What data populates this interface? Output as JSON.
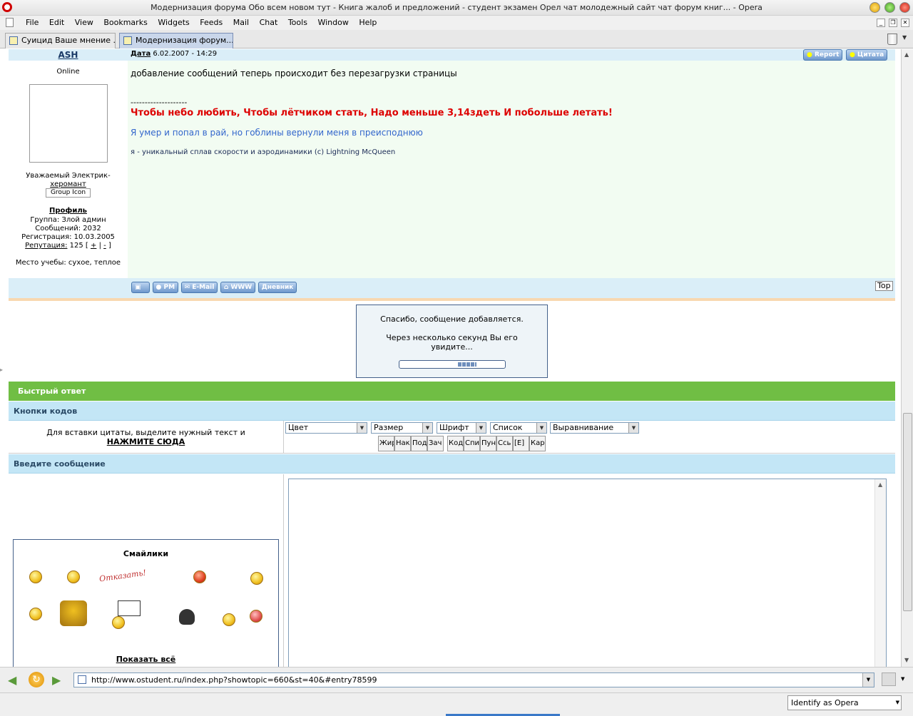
{
  "window": {
    "title": "Модернизация форума Обо всем новом тут - Книга жалоб и предложений - студент экзамен Орел чат молодежный сайт чат форум книг... - Opera"
  },
  "menu": [
    "File",
    "Edit",
    "View",
    "Bookmarks",
    "Widgets",
    "Feeds",
    "Mail",
    "Chat",
    "Tools",
    "Window",
    "Help"
  ],
  "tabs": [
    {
      "label": "Суицид Ваше мнение ..."
    },
    {
      "label": "Модернизация форум..."
    }
  ],
  "post": {
    "author": "ASH",
    "online": "Online",
    "title_line1": "Уважаемый Электрик-",
    "title_line2": "херомант",
    "group_icon": "Group Icon",
    "profile_link": "Профиль",
    "group": "Группа: Злой админ",
    "messages": "Сообщений: 2032",
    "registered": "Регистрация: 10.03.2005",
    "reputation_label": "Репутация:",
    "reputation_value": "125 [",
    "rep_plus": "+",
    "rep_sep": "|",
    "rep_minus": "-",
    "rep_close": "]",
    "study": "Место учебы: сухое, теплое",
    "date_label": "Дата",
    "date_value": "6.02.2007 - 14:29",
    "report": "Report",
    "quote": "Цитата",
    "body": "добавление сообщений теперь происходит без перезагрузки страницы",
    "divider": "--------------------",
    "sig_red": "Чтобы небо любить, Чтобы лётчиком стать, Надо меньше 3,14здеть И побольше летать!",
    "sig_blue": "Я умер и попал в рай, но гоблины вернули меня в преисподнюю",
    "sig_small": "я - уникальный сплав скорости и аэродинамики (с) Lightning McQueen",
    "buttons": {
      "pm": "PM",
      "email": "E-Mail",
      "www": "WWW",
      "diary": "Дневник"
    },
    "top": "Top"
  },
  "notice": {
    "line1": "Спасибо, сообщение добавляется.",
    "line2": "Через несколько секунд Вы его",
    "line3": "увидите...",
    "progress": 0.35
  },
  "quick_reply": {
    "header": "Быстрый ответ",
    "codes_header": "Кнопки кодов",
    "hint": "Для вставки цитаты, выделите нужный текст и",
    "click_here": "НАЖМИТЕ СЮДА",
    "selects": [
      "Цвет",
      "Размер",
      "Шрифт",
      "Список",
      "Выравнивание"
    ],
    "code_buttons": [
      "Жир",
      "Нак",
      "Под",
      "Зач",
      "Код",
      "Спи",
      "Пун",
      "Ссь",
      "[Е]",
      "Кар"
    ],
    "enter_header": "Введите сообщение",
    "smilies_title": "Смайлики",
    "smilie_text": "Отказать!",
    "show_all": "Показать всё"
  },
  "address": {
    "url": "http://www.ostudent.ru/index.php?showtopic=660&st=40&#entry78599"
  },
  "status": {
    "identify": "Identify as Opera"
  },
  "colors": {
    "accent_green": "#70be44",
    "header_blue": "#c3e6f6",
    "sig_red": "#dd0000",
    "sig_blue": "#3366cc"
  }
}
